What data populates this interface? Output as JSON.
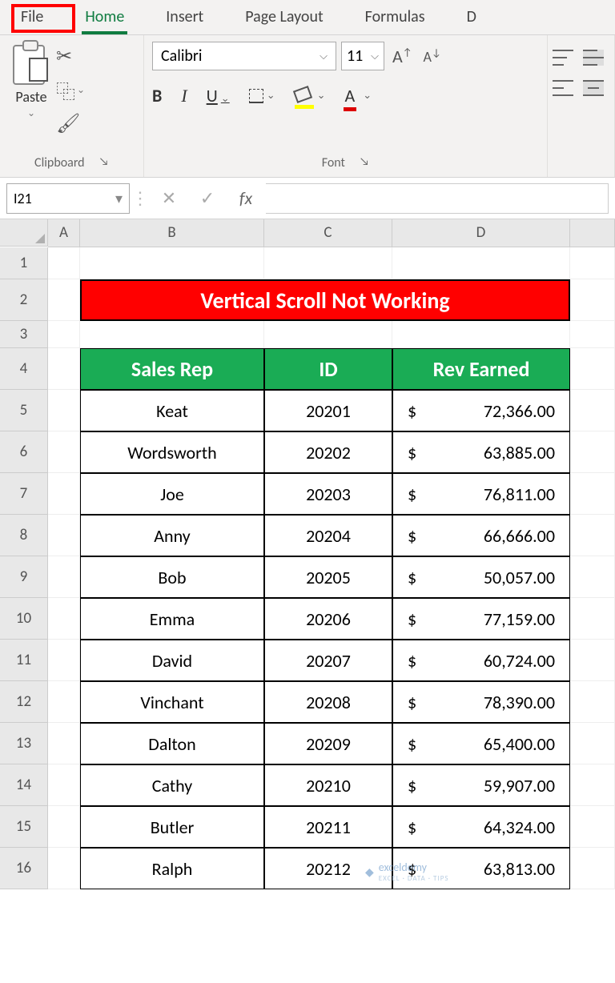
{
  "tabs": {
    "file": "File",
    "home": "Home",
    "insert": "Insert",
    "pageLayout": "Page Layout",
    "formulas": "Formulas",
    "dataPartial": "D"
  },
  "clipboard": {
    "paste": "Paste",
    "groupLabel": "Clipboard",
    "dropdownGlyph": "⌄"
  },
  "font": {
    "name": "Calibri",
    "size": "11",
    "groupLabel": "Font",
    "bold": "B",
    "italic": "I",
    "underline": "U",
    "increase": "A",
    "decrease": "A",
    "colorA": "A"
  },
  "formulaBar": {
    "nameBox": "I21",
    "fx": "fx",
    "cancel": "✕",
    "confirm": "✓",
    "menu": "⋮"
  },
  "columns": [
    "A",
    "B",
    "C",
    "D"
  ],
  "rowNumbers": [
    1,
    2,
    3,
    4,
    5,
    6,
    7,
    8,
    9,
    10,
    11,
    12,
    13,
    14,
    15,
    16
  ],
  "title": "Vertical Scroll Not Working",
  "table": {
    "headers": {
      "rep": "Sales Rep",
      "id": "ID",
      "rev": "Rev Earned"
    },
    "currency": "$",
    "rows": [
      {
        "rep": "Keat",
        "id": "20201",
        "rev": "72,366.00"
      },
      {
        "rep": "Wordsworth",
        "id": "20202",
        "rev": "63,885.00"
      },
      {
        "rep": "Joe",
        "id": "20203",
        "rev": "76,811.00"
      },
      {
        "rep": "Anny",
        "id": "20204",
        "rev": "66,666.00"
      },
      {
        "rep": "Bob",
        "id": "20205",
        "rev": "50,057.00"
      },
      {
        "rep": "Emma",
        "id": "20206",
        "rev": "77,159.00"
      },
      {
        "rep": "David",
        "id": "20207",
        "rev": "60,724.00"
      },
      {
        "rep": "Vinchant",
        "id": "20208",
        "rev": "78,390.00"
      },
      {
        "rep": "Dalton",
        "id": "20209",
        "rev": "65,400.00"
      },
      {
        "rep": "Cathy",
        "id": "20210",
        "rev": "59,907.00"
      },
      {
        "rep": "Butler",
        "id": "20211",
        "rev": "64,324.00"
      },
      {
        "rep": "Ralph",
        "id": "20212",
        "rev": "63,813.00"
      }
    ]
  },
  "watermark": {
    "main": "exceldemy",
    "sub": "EXCEL · DATA · TIPS"
  },
  "glyph": {
    "launcher": "↘",
    "dropdown": "⌵",
    "dash": "⌄"
  }
}
